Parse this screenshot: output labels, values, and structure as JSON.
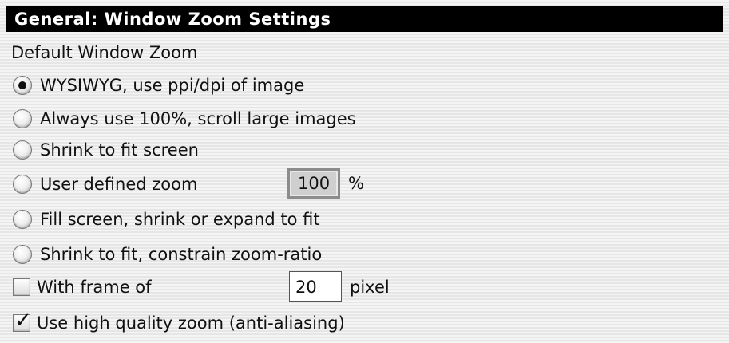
{
  "panel": {
    "title": "General: Window Zoom Settings",
    "section_label": "Default Window Zoom"
  },
  "options": [
    {
      "label": "WYSIWYG, use ppi/dpi of image",
      "selected": true
    },
    {
      "label": "Always use 100%, scroll large images",
      "selected": false
    },
    {
      "label": "Shrink to fit screen",
      "selected": false
    },
    {
      "label": "User defined zoom",
      "selected": false
    },
    {
      "label": "Fill screen, shrink or expand to fit",
      "selected": false
    },
    {
      "label": "Shrink to fit, constrain zoom-ratio",
      "selected": false
    }
  ],
  "user_zoom": {
    "value": "100",
    "unit": "%"
  },
  "frame": {
    "label": "With frame of",
    "checked": false,
    "value": "20",
    "unit": "pixel"
  },
  "high_quality": {
    "label": "Use high quality zoom (anti-aliasing)",
    "checked": true
  }
}
